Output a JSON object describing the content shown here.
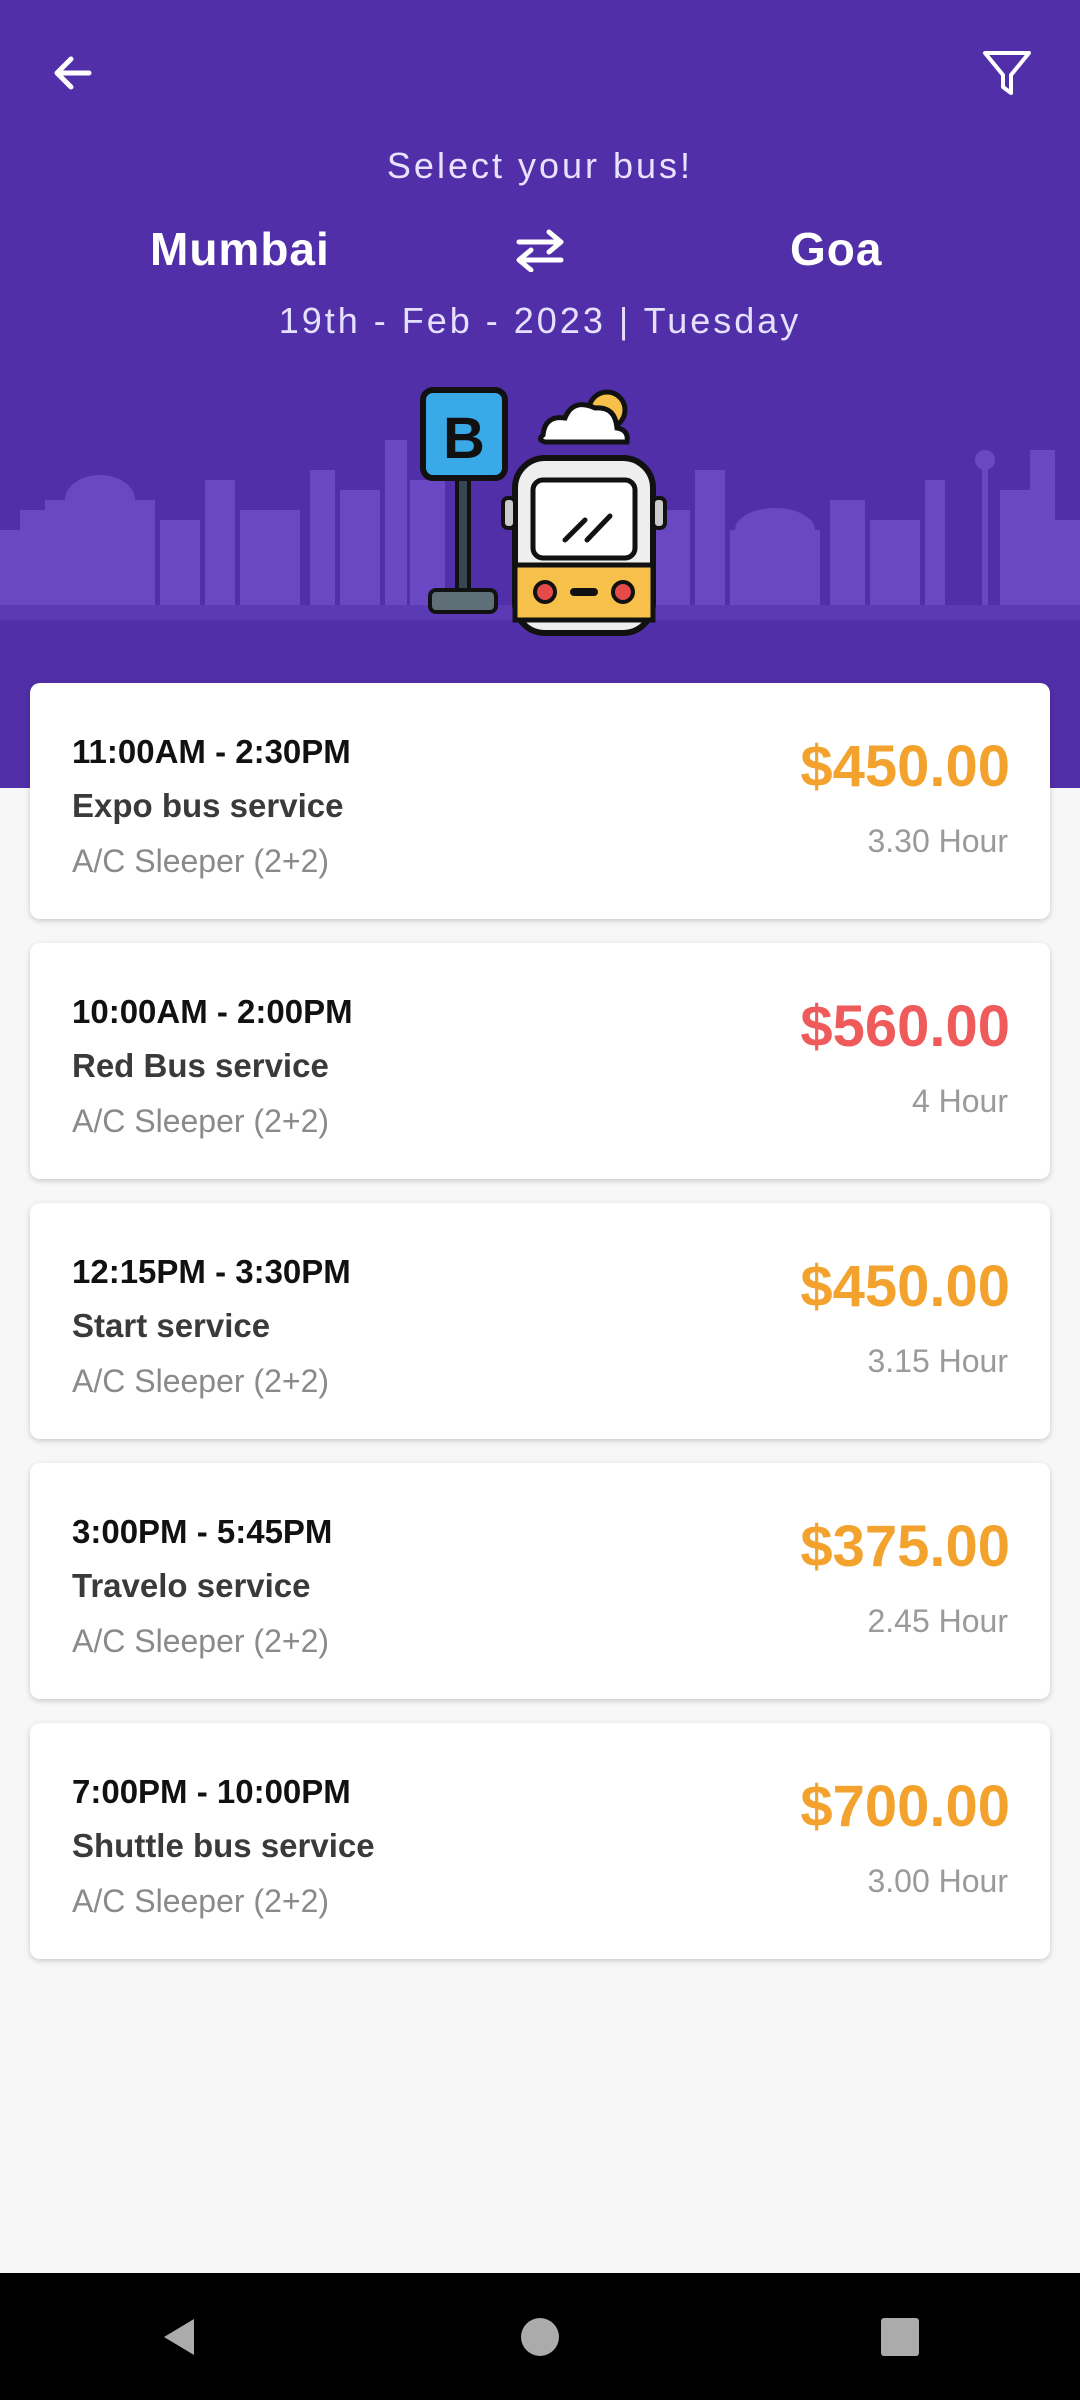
{
  "header": {
    "subtitle": "Select your bus!",
    "from_city": "Mumbai",
    "to_city": "Goa",
    "date": "19th - Feb - 2023 | Tuesday",
    "bus_stop_sign": "B",
    "back_icon": "arrow-left-icon",
    "filter_icon": "filter-icon",
    "swap_icon": "swap-icon",
    "background_color": "#512fa8"
  },
  "buses": [
    {
      "time": "11:00AM - 2:30PM",
      "operator": "Expo bus service",
      "type": "A/C Sleeper (2+2)",
      "price": "$450.00",
      "duration": "3.30 Hour",
      "price_color": "#f2a22d"
    },
    {
      "time": "10:00AM - 2:00PM",
      "operator": "Red Bus service",
      "type": "A/C Sleeper (2+2)",
      "price": "$560.00",
      "duration": "4 Hour",
      "price_color": "#ef5a5a"
    },
    {
      "time": "12:15PM - 3:30PM",
      "operator": "Start service",
      "type": "A/C Sleeper (2+2)",
      "price": "$450.00",
      "duration": "3.15 Hour",
      "price_color": "#f2a22d"
    },
    {
      "time": "3:00PM - 5:45PM",
      "operator": "Travelo service",
      "type": "A/C Sleeper (2+2)",
      "price": "$375.00",
      "duration": "2.45 Hour",
      "price_color": "#f2a22d"
    },
    {
      "time": "7:00PM - 10:00PM",
      "operator": "Shuttle bus service",
      "type": "A/C Sleeper (2+2)",
      "price": "$700.00",
      "duration": "3.00 Hour",
      "price_color": "#f2a22d"
    }
  ],
  "navbar": {
    "back_icon": "nav-back-triangle-icon",
    "home_icon": "nav-home-circle-icon",
    "recents_icon": "nav-recents-square-icon"
  }
}
